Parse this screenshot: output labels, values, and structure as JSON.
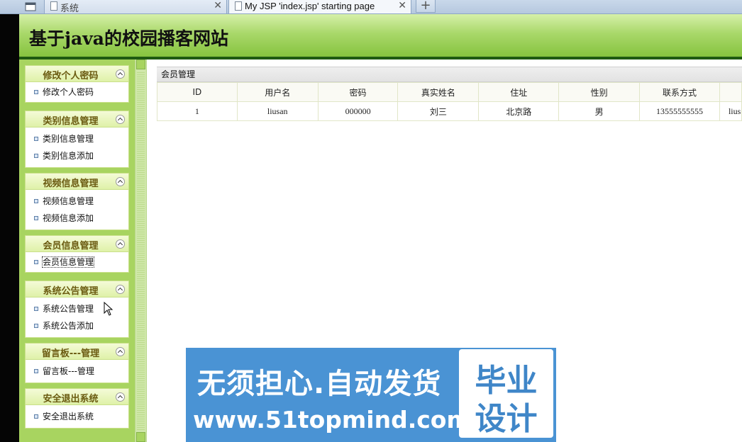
{
  "browser": {
    "tabs": [
      {
        "title": "系统",
        "active": false
      },
      {
        "title": "My JSP 'index.jsp' starting page",
        "active": true
      }
    ],
    "close_glyph": "✕",
    "new_tab_glyph": "+"
  },
  "header": {
    "title": "基于java的校园播客网站"
  },
  "sidebar": {
    "panels": [
      {
        "title": "修改个人密码",
        "items": [
          "修改个人密码"
        ]
      },
      {
        "title": "类别信息管理",
        "items": [
          "类别信息管理",
          "类别信息添加"
        ]
      },
      {
        "title": "视频信息管理",
        "items": [
          "视频信息管理",
          "视频信息添加"
        ]
      },
      {
        "title": "会员信息管理",
        "items": [
          "会员信息管理"
        ]
      },
      {
        "title": "系统公告管理",
        "items": [
          "系统公告管理",
          "系统公告添加"
        ]
      },
      {
        "title": "留言板---管理",
        "items": [
          "留言板---管理"
        ]
      },
      {
        "title": "安全退出系统",
        "items": [
          "安全退出系统"
        ]
      }
    ]
  },
  "main": {
    "grid_title": "会员管理",
    "columns": [
      "ID",
      "用户名",
      "密码",
      "真实姓名",
      "住址",
      "性别",
      "联系方式",
      ""
    ],
    "rows": [
      [
        "1",
        "liusan",
        "000000",
        "刘三",
        "北京路",
        "男",
        "13555555555",
        "lius"
      ]
    ]
  },
  "banner": {
    "line1": "无须担心.自动发货",
    "line2": "www.51topmind.com",
    "box_line1": "毕业",
    "box_line2": "设计",
    "bg_color": "#4a93d4"
  },
  "colors": {
    "header_green": "#86c33f",
    "sidebar_green": "#a8d460",
    "panel_title": "#6a5a10"
  }
}
